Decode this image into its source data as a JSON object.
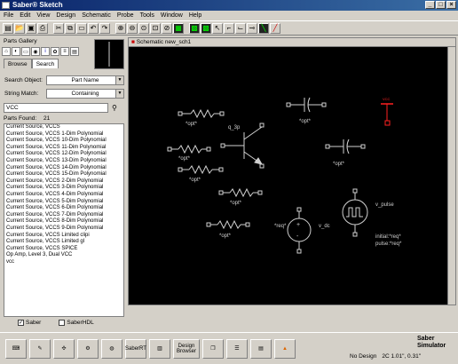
{
  "window": {
    "title": "Saber® Sketch",
    "controls": [
      "_",
      "□",
      "×"
    ]
  },
  "menu": [
    "File",
    "Edit",
    "View",
    "Design",
    "Schematic",
    "Probe",
    "Tools",
    "Window",
    "Help"
  ],
  "gallery": {
    "title": "Parts Gallery",
    "tabs": [
      "Browse",
      "Search"
    ],
    "search_object_label": "Search Object:",
    "search_object_value": "Part Name",
    "string_match_label": "String Match:",
    "string_match_value": "Containing",
    "search_value": "VCC",
    "parts_found_label": "Parts Found:",
    "parts_found_count": "21",
    "parts": [
      "Current Source, VCCS",
      "Current Source, VCCS 1-Dim Polynomial",
      "Current Source, VCCS 10-Dim Polynomial",
      "Current Source, VCCS 11-Dim Polynomial",
      "Current Source, VCCS 12-Dim Polynomial",
      "Current Source, VCCS 13-Dim Polynomial",
      "Current Source, VCCS 14-Dim Polynomial",
      "Current Source, VCCS 15-Dim Polynomial",
      "Current Source, VCCS 2-Dim Polynomial",
      "Current Source, VCCS 3-Dim Polynomial",
      "Current Source, VCCS 4-Dim Polynomial",
      "Current Source, VCCS 5-Dim Polynomial",
      "Current Source, VCCS 6-Dim Polynomial",
      "Current Source, VCCS 7-Dim Polynomial",
      "Current Source, VCCS 8-Dim Polynomial",
      "Current Source, VCCS 9-Dim Polynomial",
      "Current Source, VCCS Limited clipi",
      "Current Source, VCCS Limited gl",
      "Current Source, VCCS SPICE",
      "Op Amp, Level 3, Dual VCC",
      "vcc"
    ],
    "check_saber": "Saber",
    "check_saberhdl": "SaberHDL"
  },
  "schematic": {
    "title": "Schematic new_sch1",
    "labels": {
      "opt": "*opt*",
      "q": "q_3p",
      "req": "*req*",
      "vdc": "v_dc",
      "vpulse": "v_pulse",
      "initial": "initial:*req*",
      "pulse": "pulse:*req*",
      "vcc": "VCC"
    }
  },
  "bottom_tools": [
    "SaberRT",
    "Design Browser"
  ],
  "status": {
    "design": "No Design",
    "coords": "2C  1.01\",  0.31\""
  },
  "brand": {
    "top": "Saber",
    "bottom": "Simulator"
  },
  "colors": {
    "wire": "#d0d0d0",
    "vcc_red": "#ff2020",
    "title_blue": "#0a246a"
  }
}
